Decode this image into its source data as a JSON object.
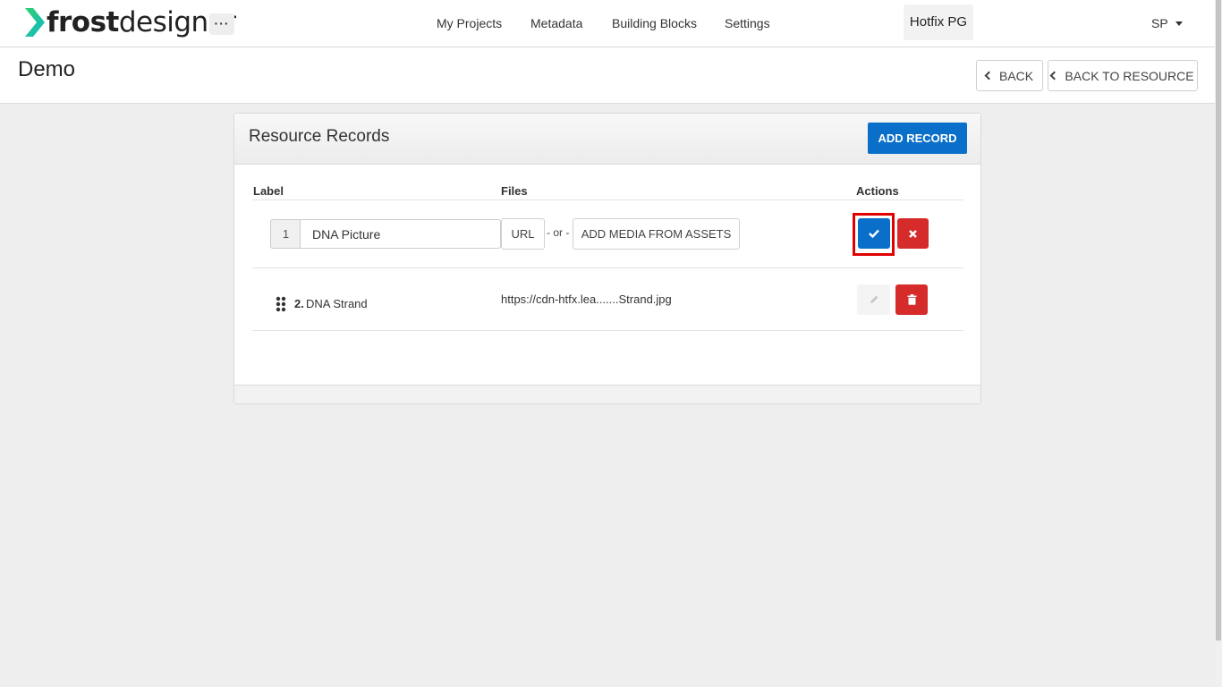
{
  "app": {
    "logo_bold": "frost",
    "logo_light": "designer",
    "more_menu": "···"
  },
  "nav": {
    "items": [
      "My Projects",
      "Metadata",
      "Building Blocks",
      "Settings"
    ]
  },
  "project": {
    "name": "Hotfix PG"
  },
  "user": {
    "initials": "SP"
  },
  "page": {
    "title": "Demo",
    "back_label": "BACK",
    "back_to_resource_label": "BACK TO RESOURCE"
  },
  "panel": {
    "title": "Resource Records",
    "add_record_label": "ADD RECORD",
    "columns": {
      "label": "Label",
      "files": "Files",
      "actions": "Actions"
    }
  },
  "records": [
    {
      "number": "1",
      "label_value": "DNA Picture",
      "url_label": "URL",
      "or_text": "- or -",
      "assets_label": "ADD MEDIA FROM ASSETS"
    },
    {
      "number": "2.",
      "label": "DNA Strand",
      "file": "https://cdn-htfx.lea.......Strand.jpg"
    }
  ],
  "colors": {
    "primary": "#0a6fc9",
    "danger": "#d52b2b",
    "logo_accent": "#1fc9a8",
    "highlight": "#e00000"
  },
  "icons": {
    "confirm": "check-icon",
    "cancel": "x-icon",
    "edit": "pencil-icon",
    "delete": "trash-icon",
    "drag": "drag-handle-icon",
    "back": "chevron-left-icon",
    "user_menu": "caret-down-icon"
  }
}
